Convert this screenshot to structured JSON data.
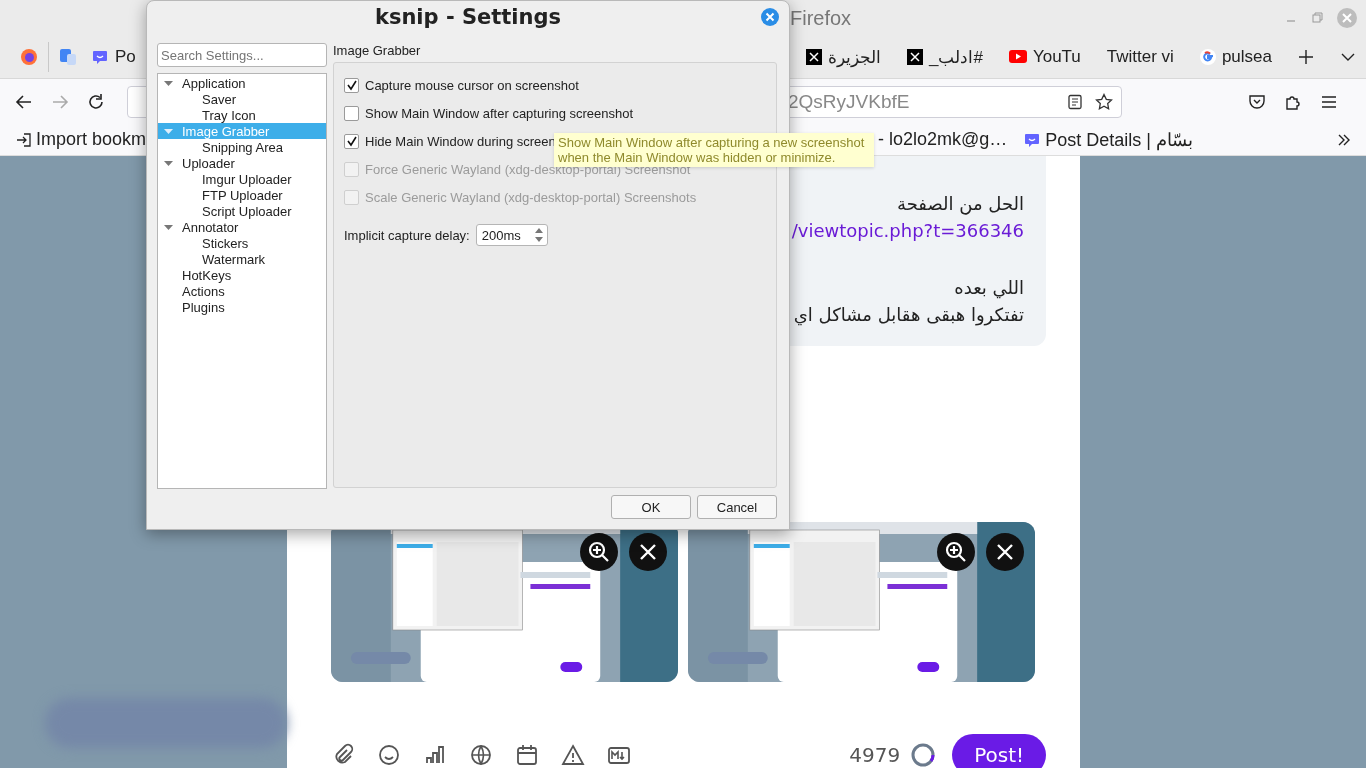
{
  "browser": {
    "window_title": "Firefox",
    "tabs": [
      {
        "label": "Po",
        "kind": "mastodon"
      },
      {
        "label": "الجزيرة",
        "kind": "x"
      },
      {
        "label": "#ادلب_",
        "kind": "x"
      },
      {
        "label": "YouTu",
        "kind": "youtube"
      },
      {
        "label": "Twitter vi",
        "kind": "plain"
      },
      {
        "label": "pulsea",
        "kind": "google"
      }
    ],
    "address": "2QsRyJVKbfE",
    "bookmarks": [
      {
        "label": "Import bookm",
        "kind": "import"
      },
      {
        "label": "- lo2lo2mk@g…",
        "kind": "plain"
      },
      {
        "label": "Post Details | بسّام",
        "kind": "mastodon"
      }
    ]
  },
  "post": {
    "paragraphs": [
      {
        "lines": [
          {
            "text": "الحل من الصفحة",
            "kind": "text"
          },
          {
            "text": "/viewtopic.php?t=366346",
            "kind": "link"
          }
        ]
      },
      {
        "lines": [
          {
            "text": "اللي بعده",
            "kind": "text"
          },
          {
            "text": "تفتكروا هبقى هقابل مشاكل اي",
            "kind": "text"
          }
        ]
      }
    ],
    "counter": "4979",
    "submit": "Post!"
  },
  "dialog": {
    "title": "ksnip - Settings",
    "search": {
      "placeholder": "Search Settings..."
    },
    "tree": [
      {
        "label": "Application",
        "expanded": true,
        "selected": false,
        "children": [
          {
            "label": "Saver",
            "selected": false
          },
          {
            "label": "Tray Icon",
            "selected": false
          }
        ]
      },
      {
        "label": "Image Grabber",
        "expanded": true,
        "selected": true,
        "children": [
          {
            "label": "Snipping Area",
            "selected": false
          }
        ]
      },
      {
        "label": "Uploader",
        "expanded": true,
        "selected": false,
        "children": [
          {
            "label": "Imgur Uploader",
            "selected": false
          },
          {
            "label": "FTP Uploader",
            "selected": false
          },
          {
            "label": "Script Uploader",
            "selected": false
          }
        ]
      },
      {
        "label": "Annotator",
        "expanded": true,
        "selected": false,
        "children": [
          {
            "label": "Stickers",
            "selected": false
          },
          {
            "label": "Watermark",
            "selected": false
          }
        ]
      },
      {
        "label": "HotKeys",
        "selected": false
      },
      {
        "label": "Actions",
        "selected": false
      },
      {
        "label": "Plugins",
        "selected": false
      }
    ],
    "section": "Image Grabber",
    "options": [
      {
        "label": "Capture mouse cursor on screenshot",
        "checked": true,
        "disabled": false
      },
      {
        "label": "Show Main Window after capturing screenshot",
        "checked": false,
        "disabled": false
      },
      {
        "label": "Hide Main Window during screen",
        "checked": true,
        "disabled": false
      },
      {
        "label": "Force Generic Wayland (xdg-desktop-portal) Screenshot",
        "checked": false,
        "disabled": true
      },
      {
        "label": "Scale Generic Wayland (xdg-desktop-portal) Screenshots",
        "checked": false,
        "disabled": true
      }
    ],
    "delay": {
      "label": "Implicit capture delay:",
      "value": "200ms"
    },
    "buttons": [
      "OK",
      "Cancel"
    ],
    "tooltip": "Show Main Window after capturing a new screenshot when the Main Window was hidden or minimize."
  }
}
